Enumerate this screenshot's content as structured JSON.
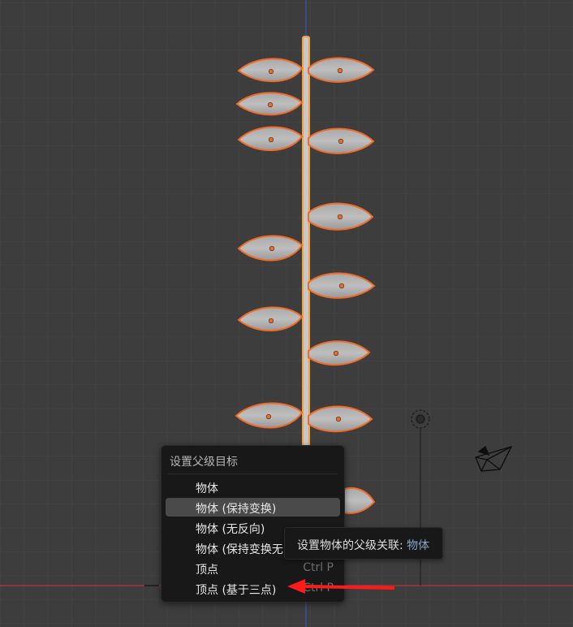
{
  "viewport": {
    "background": "#3d3d3d",
    "selection_color": "#f06a28",
    "axis_x_color": "#b03a3a",
    "axis_z_color": "#3a57b0",
    "icons": [
      "light-icon",
      "camera-icon"
    ]
  },
  "menu": {
    "title": "设置父级目标",
    "items": [
      {
        "label": "物体",
        "shortcut": ""
      },
      {
        "label": "物体 (保持变换)",
        "shortcut": "",
        "highlighted": true
      },
      {
        "label": "物体 (无反向)",
        "shortcut": ""
      },
      {
        "label": "物体 (保持变换无",
        "shortcut": ""
      },
      {
        "label": "顶点",
        "shortcut": "Ctrl P"
      },
      {
        "label": "顶点 (基于三点)",
        "shortcut": "Ctrl P"
      }
    ]
  },
  "tooltip": {
    "prefix": "设置物体的父级关联:",
    "value": "物体"
  },
  "annotation": {
    "arrow_color": "#ff1a1a"
  }
}
